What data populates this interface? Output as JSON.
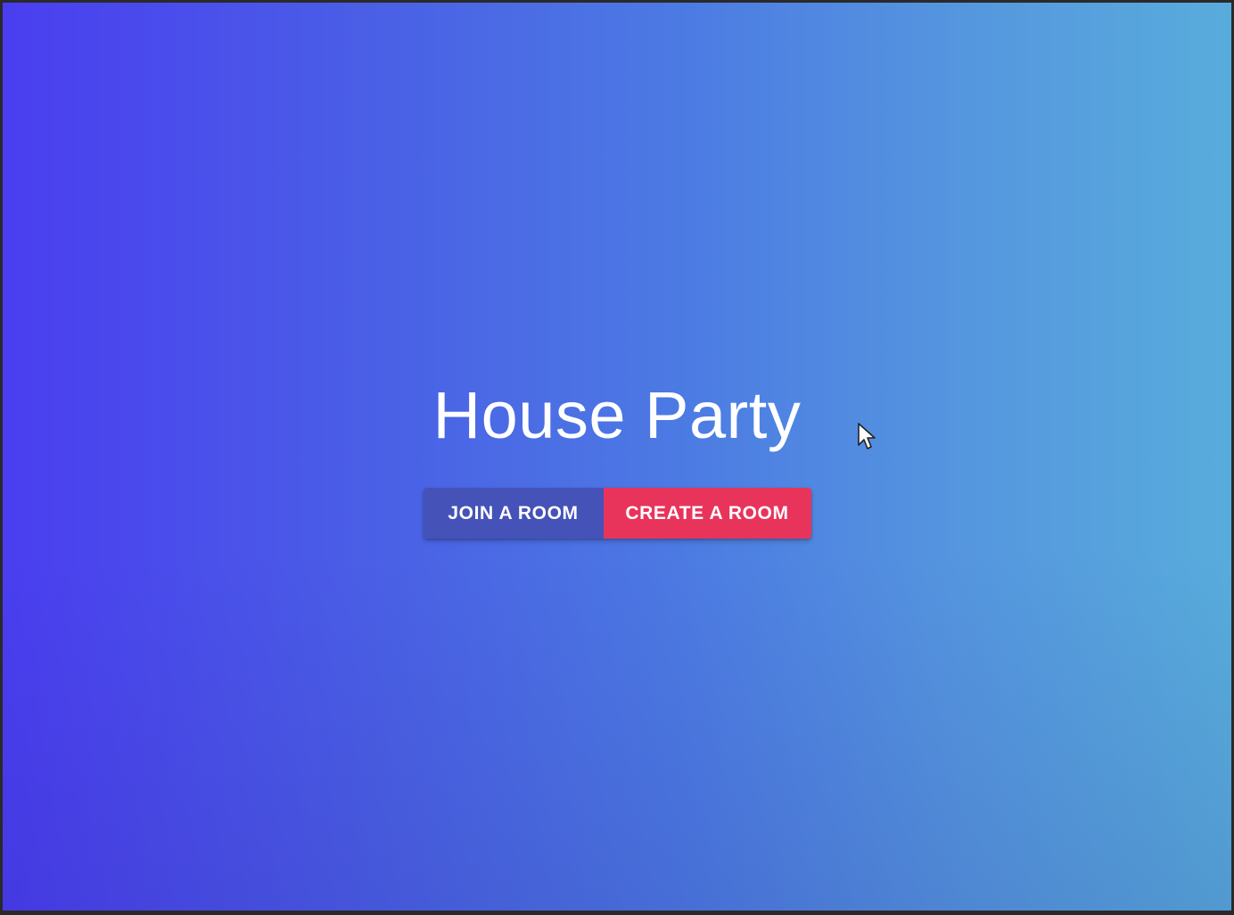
{
  "app": {
    "title": "House Party"
  },
  "actions": {
    "join_label": "JOIN A ROOM",
    "create_label": "CREATE A ROOM"
  },
  "colors": {
    "gradient_start": "#4a3ef0",
    "gradient_end": "#58acdc",
    "join_button": "#4552b8",
    "create_button": "#e8345b",
    "text": "#ffffff"
  },
  "icons": {
    "pointer": "mouse-pointer-icon"
  }
}
